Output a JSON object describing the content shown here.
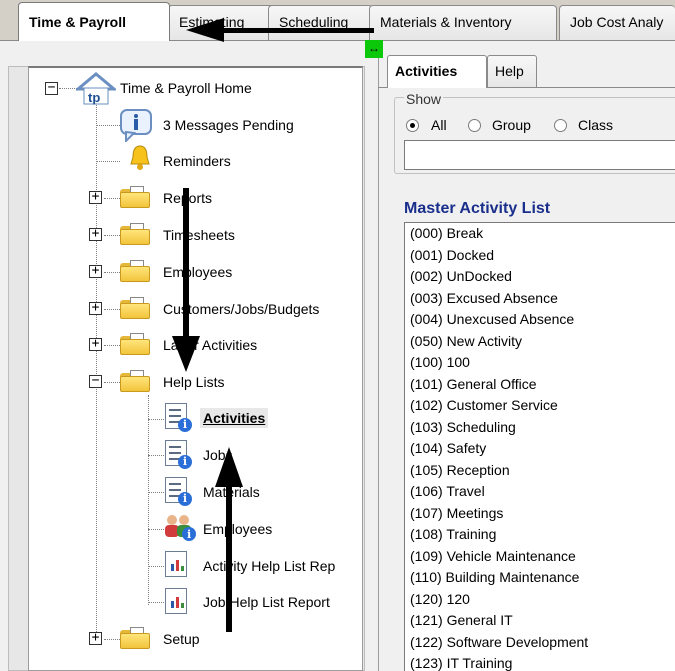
{
  "top_tabs": [
    {
      "label": "Time & Payroll",
      "active": true
    },
    {
      "label": "Estimating",
      "active": false
    },
    {
      "label": "Scheduling",
      "active": false
    },
    {
      "label": "Materials & Inventory",
      "active": false
    },
    {
      "label": "Job Cost Analy",
      "active": false
    }
  ],
  "splitter_glyph": "↔",
  "tree": {
    "root": {
      "label": "Time & Payroll Home",
      "icon": "home-icon",
      "icon_text": "tp"
    },
    "items": [
      {
        "label": "3 Messages Pending",
        "icon": "info-icon"
      },
      {
        "label": "Reminders",
        "icon": "bell-icon"
      },
      {
        "label": "Reports",
        "icon": "folder-icon",
        "expander": "+"
      },
      {
        "label": "Timesheets",
        "icon": "folder-icon",
        "expander": "+"
      },
      {
        "label": "Employees",
        "icon": "folder-icon",
        "expander": "+"
      },
      {
        "label": "Customers/Jobs/Budgets",
        "icon": "folder-icon",
        "expander": "+"
      },
      {
        "label": "Labor Activities",
        "icon": "folder-icon",
        "expander": "+"
      },
      {
        "label": "Help Lists",
        "icon": "folder-icon",
        "expander": "−"
      },
      {
        "label": "Setup",
        "icon": "folder-icon",
        "expander": "+"
      }
    ],
    "help_children": [
      {
        "label": "Activities",
        "icon": "list-info-icon",
        "selected": true
      },
      {
        "label": "Jobs",
        "icon": "checklist-info-icon",
        "selected": false
      },
      {
        "label": "Materials",
        "icon": "numbered-list-info-icon",
        "selected": false
      },
      {
        "label": "Employees",
        "icon": "people-info-icon",
        "selected": false
      },
      {
        "label": "Activity Help List Rep",
        "icon": "report-chart-icon",
        "selected": false
      },
      {
        "label": "Job Help List Report",
        "icon": "report-chart-icon",
        "selected": false
      }
    ]
  },
  "sub_tabs": [
    {
      "label": "Activities",
      "active": true
    },
    {
      "label": "Help",
      "active": false
    }
  ],
  "show_group": {
    "legend": "Show",
    "options": [
      {
        "label": "All",
        "checked": true
      },
      {
        "label": "Group",
        "checked": false
      },
      {
        "label": "Class",
        "checked": false
      }
    ],
    "filter_value": ""
  },
  "master_list": {
    "title": "Master Activity List",
    "items": [
      "(000) Break",
      "(001) Docked",
      "(002) UnDocked",
      "(003) Excused Absence",
      "(004) Unexcused Absence",
      "(050) New Activity",
      "(100) 100",
      "(101) General Office",
      "(102) Customer Service",
      "(103) Scheduling",
      "(104) Safety",
      "(105) Reception",
      "(106) Travel",
      "(107) Meetings",
      "(108) Training",
      "(109) Vehicle Maintenance",
      "(110) Building Maintenance",
      "(120) 120",
      "(121) General IT",
      "(122) Software Development",
      "(123) IT Training"
    ]
  },
  "colors": {
    "master_title": "#1a2e8c",
    "splitter": "#0bc80b",
    "folder": "#f2c43c",
    "info_badge": "#2a6fd8",
    "annotation_arrow": "#000000"
  }
}
